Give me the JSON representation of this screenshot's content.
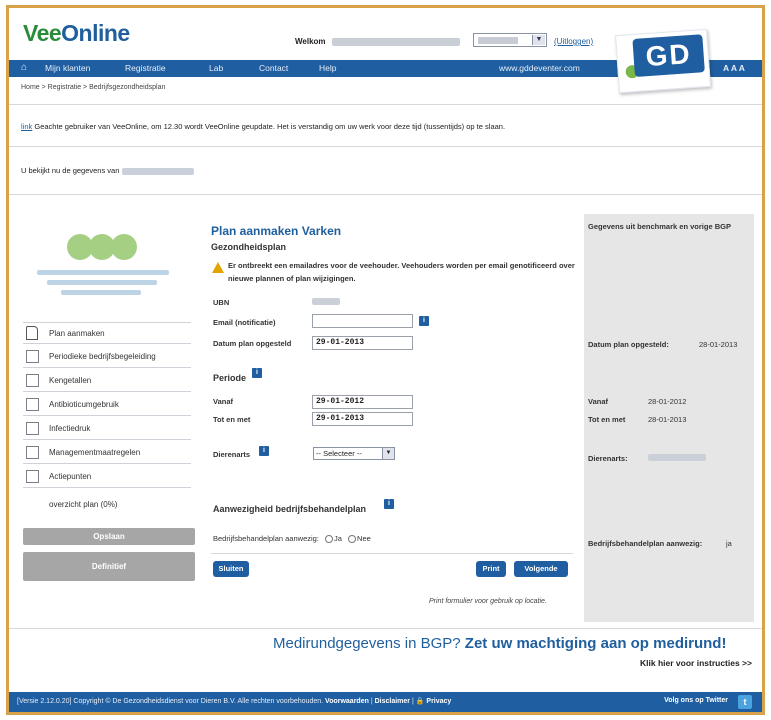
{
  "header": {
    "logo_vee": "Vee",
    "logo_online": "Online",
    "welcome_label": "Welkom",
    "logout": "(Uitloggen)",
    "gd_logo": "GD"
  },
  "nav": {
    "home_icon": "home-icon",
    "items": [
      "Mijn klanten",
      "Registratie",
      "Lab",
      "Contact",
      "Help"
    ],
    "website": "www.gddeventer.com",
    "text_size": "A A A"
  },
  "breadcrumb": "Home > Registratie > Bedrijfsgezondheidsplan",
  "notice": {
    "link": "link",
    "text": "Geachte gebruiker van VeeOnline, om 12.30 wordt VeeOnline geupdate. Het is verstandig om uw werk voor deze tijd (tussentijds) op te slaan."
  },
  "viewing": "U bekijkt nu de gegevens van",
  "sidebar": {
    "items": [
      {
        "label": "Plan aanmaken",
        "icon": "document-icon"
      },
      {
        "label": "Periodieke bedrijfsbegeleiding"
      },
      {
        "label": "Kengetallen"
      },
      {
        "label": "Antibioticumgebruik"
      },
      {
        "label": "Infectiedruk"
      },
      {
        "label": "Managementmaatregelen"
      },
      {
        "label": "Actiepunten"
      }
    ],
    "overview": "overzicht plan (0%)",
    "save": "Opslaan",
    "final": "Definitief"
  },
  "form": {
    "title": "Plan aanmaken Varken",
    "subtitle": "Gezondheidsplan",
    "warning": "Er ontbreekt een emailadres voor de veehouder. Veehouders worden per email genotificeerd over nieuwe plannen of plan wijzigingen.",
    "ubn_label": "UBN",
    "email_label": "Email (notificatie)",
    "email_value": "",
    "plan_date_label": "Datum plan opgesteld",
    "plan_date_value": "29-01-2013",
    "period_head": "Periode",
    "from_label": "Vanaf",
    "from_value": "29-01-2012",
    "to_label": "Tot en met",
    "to_value": "29-01-2013",
    "vet_label": "Dierenarts",
    "vet_select": "-- Selecteer --",
    "treat_head": "Aanwezigheid bedrijfsbehandelplan",
    "treat_question": "Bedrijfsbehandelplan aanwezig:",
    "opt_yes": "Ja",
    "opt_no": "Nee",
    "close": "Sluiten",
    "print": "Print",
    "next": "Volgende",
    "print_note": "Print formulier voor gebruik op locatie."
  },
  "right_panel": {
    "title": "Gegevens uit benchmark en vorige BGP",
    "plan_date_label": "Datum plan opgesteld:",
    "plan_date_value": "28-01-2013",
    "from_label": "Vanaf",
    "from_value": "28-01-2012",
    "to_label": "Tot en met",
    "to_value": "28-01-2013",
    "vet_label": "Dierenarts:",
    "treat_label": "Bedrijfsbehandelplan aanwezig:",
    "treat_value": "ja"
  },
  "banner": {
    "part1": "Medirundgegevens in BGP?",
    "part2": "Zet uw machtiging aan op medirund!",
    "link": "Klik hier voor instructies  >>"
  },
  "footer": {
    "copyright": "[Versie 2.12.0.20] Copyright © De Gezondheidsdienst voor Dieren B.V. Alle rechten voorbehouden.",
    "terms": "Voorwaarden",
    "disclaimer": "Disclaimer",
    "privacy": "Privacy",
    "twitter_text": "Volg ons op Twitter",
    "twitter_icon": "twitter-icon"
  },
  "colors": {
    "brand_blue": "#1f5ea0",
    "brand_green": "#2a8c3a",
    "frame": "#d9a24a"
  }
}
